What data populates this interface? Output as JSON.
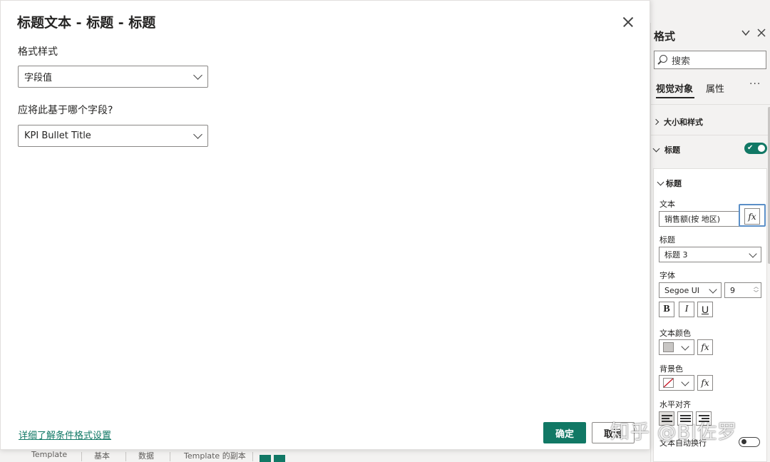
{
  "format_pane": {
    "title": "格式",
    "search_placeholder": "搜索",
    "tabs": [
      {
        "label": "视觉对象",
        "active": true
      },
      {
        "label": "属性",
        "active": false
      }
    ],
    "more": "···",
    "sections": {
      "size_style": "大小和样式",
      "title_section": "标题",
      "title_section_toggle": "on"
    },
    "title_card": {
      "header": "标题",
      "text_label": "文本",
      "text_value": "销售额(按 地区)",
      "fx": "fx",
      "heading_label": "标题",
      "heading_value": "标题 3",
      "font_label": "字体",
      "font_value": "Segoe UI",
      "font_size": "9",
      "bold": "B",
      "italic": "I",
      "underline": "U",
      "text_color_label": "文本颜色",
      "text_color": "#c8c6c4",
      "background_color_label": "背景色",
      "background_color": "none",
      "horizontal_align_label": "水平对齐",
      "horizontal_align_selected": "left",
      "wrap_label": "文本自动换行",
      "wrap_toggle": "off"
    }
  },
  "dialog": {
    "title": "标题文本 - 标题 - 标题",
    "format_style_label": "格式样式",
    "format_style_value": "字段值",
    "field_label": "应将此基于哪个字段?",
    "field_value": "KPI Bullet Title",
    "learn_more_link": "详细了解条件格式设置",
    "ok_label": "确定",
    "cancel_label": "取消"
  },
  "bottom_tabs": [
    "Template",
    "基本",
    "数据",
    "Template 的副本"
  ],
  "watermark": "知乎 @BI佐罗",
  "colors": {
    "accent": "#117865",
    "highlight_border": "#5b8fc7",
    "pane_bg": "#f3f2f1",
    "no_color_slash": "#c50f1f"
  }
}
